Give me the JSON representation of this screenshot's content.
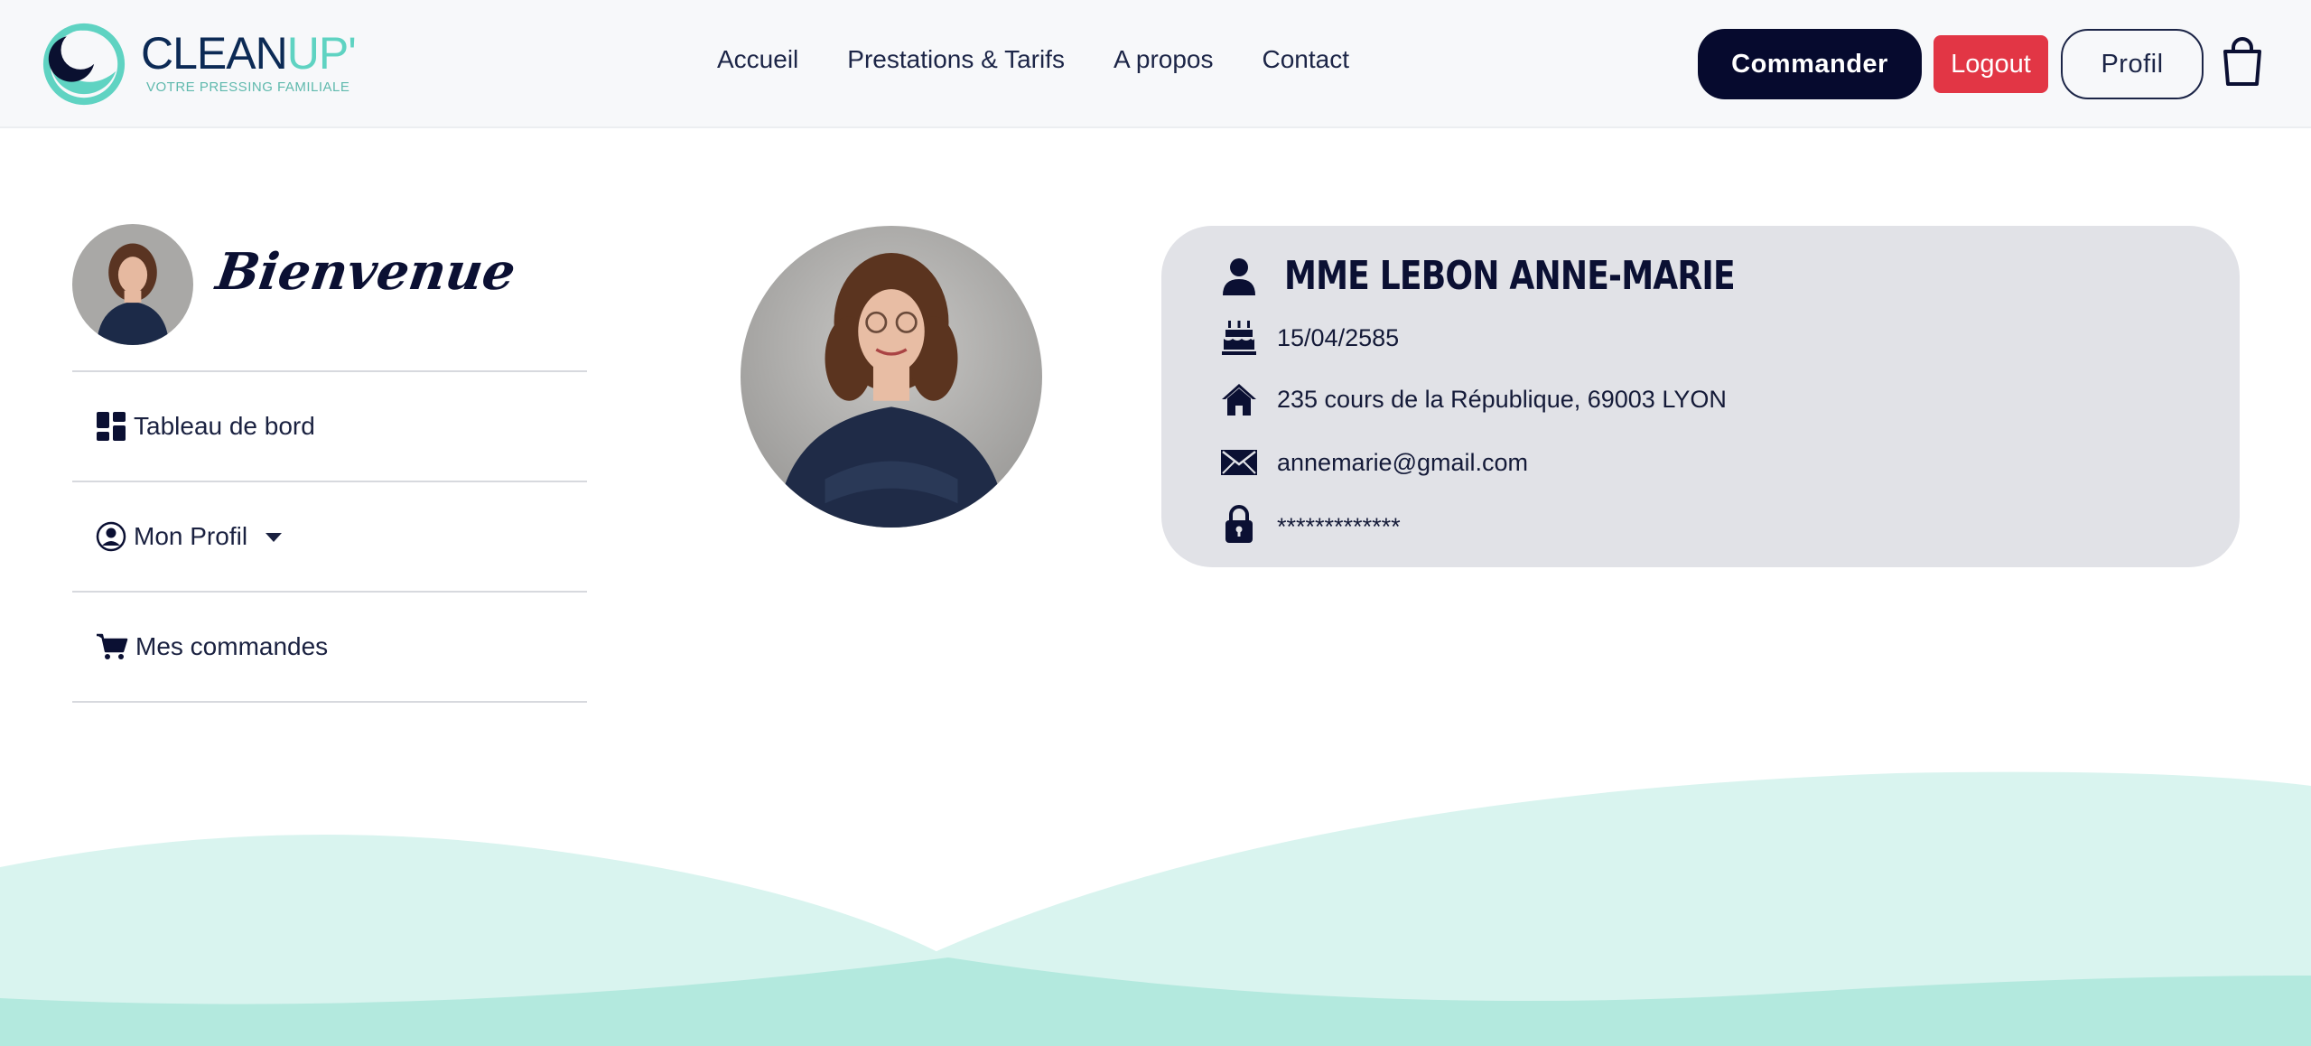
{
  "brand": {
    "name_part1": "CLEAN",
    "name_part2": "UP'",
    "tagline": "VOTRE PRESSING FAMILIALE",
    "colors": {
      "navy": "#0c2a55",
      "teal": "#5fd3c2"
    }
  },
  "nav": {
    "links": [
      "Accueil",
      "Prestations & Tarifs",
      "A propos",
      "Contact"
    ],
    "commander_label": "Commander",
    "logout_label": "Logout",
    "profil_label": "Profil",
    "cart_icon": "shopping-bag-icon"
  },
  "sidebar": {
    "welcome": "Bienvenue",
    "items": [
      {
        "label": "Tableau de bord",
        "icon": "dashboard-icon"
      },
      {
        "label": "Mon Profil",
        "icon": "user-circle-icon",
        "has_dropdown": true
      },
      {
        "label": "Mes commandes",
        "icon": "cart-icon"
      }
    ]
  },
  "profile": {
    "name": "MME LEBON ANNE-MARIE",
    "birthdate": "15/04/2585",
    "address": "235 cours de la République, 69003 LYON",
    "email": "annemarie@gmail.com",
    "password_mask": "*************"
  },
  "colors": {
    "primary_button": "#060a2e",
    "logout_button": "#e23645",
    "card_background": "#e1e2e7",
    "wave_light": "#d9f4ef",
    "wave_mid": "#b3e9de"
  }
}
